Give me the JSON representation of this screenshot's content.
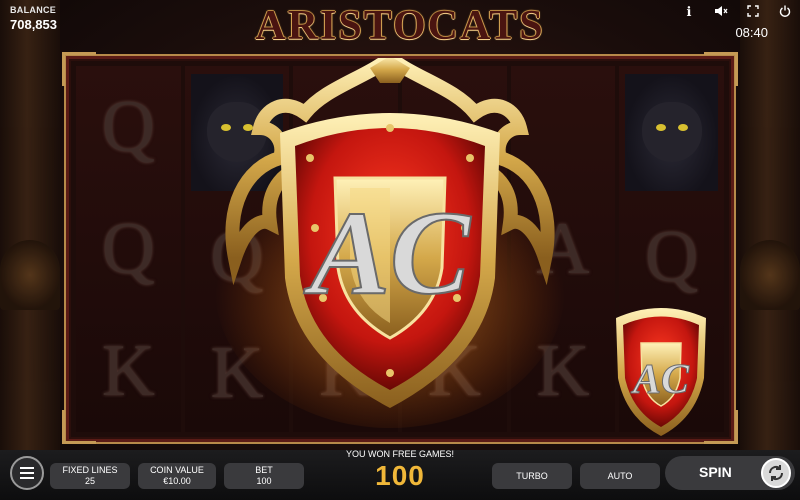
{
  "header": {
    "balance_label": "BALANCE",
    "balance_value": "708,853",
    "game_title": "ARISTOCATS",
    "clock": "08:40",
    "icons": [
      "info-icon",
      "mute-icon",
      "fullscreen-icon",
      "power-icon"
    ]
  },
  "reels": [
    [
      "Q",
      "Q",
      "K"
    ],
    [
      "cat-portrait",
      "Q",
      "K"
    ],
    [
      "",
      "",
      "K"
    ],
    [
      "",
      "",
      "K"
    ],
    [
      "",
      "A",
      "K"
    ],
    [
      "cat-portrait",
      "Q",
      "shield"
    ]
  ],
  "shield_monogram": "AC",
  "bottom": {
    "fixed_lines_label": "FIXED LINES",
    "fixed_lines_value": "25",
    "coin_value_label": "COIN VALUE",
    "coin_value_value": "€10.00",
    "bet_label": "BET",
    "bet_value": "100",
    "message": "YOU WON FREE GAMES!",
    "free_games": "100",
    "turbo_label": "TURBO",
    "auto_label": "AUTO",
    "spin_label": "SPIN"
  },
  "colors": {
    "accent_gold": "#f0b739",
    "shield_red": "#c4160f",
    "title_dark_red": "#4a1410"
  }
}
